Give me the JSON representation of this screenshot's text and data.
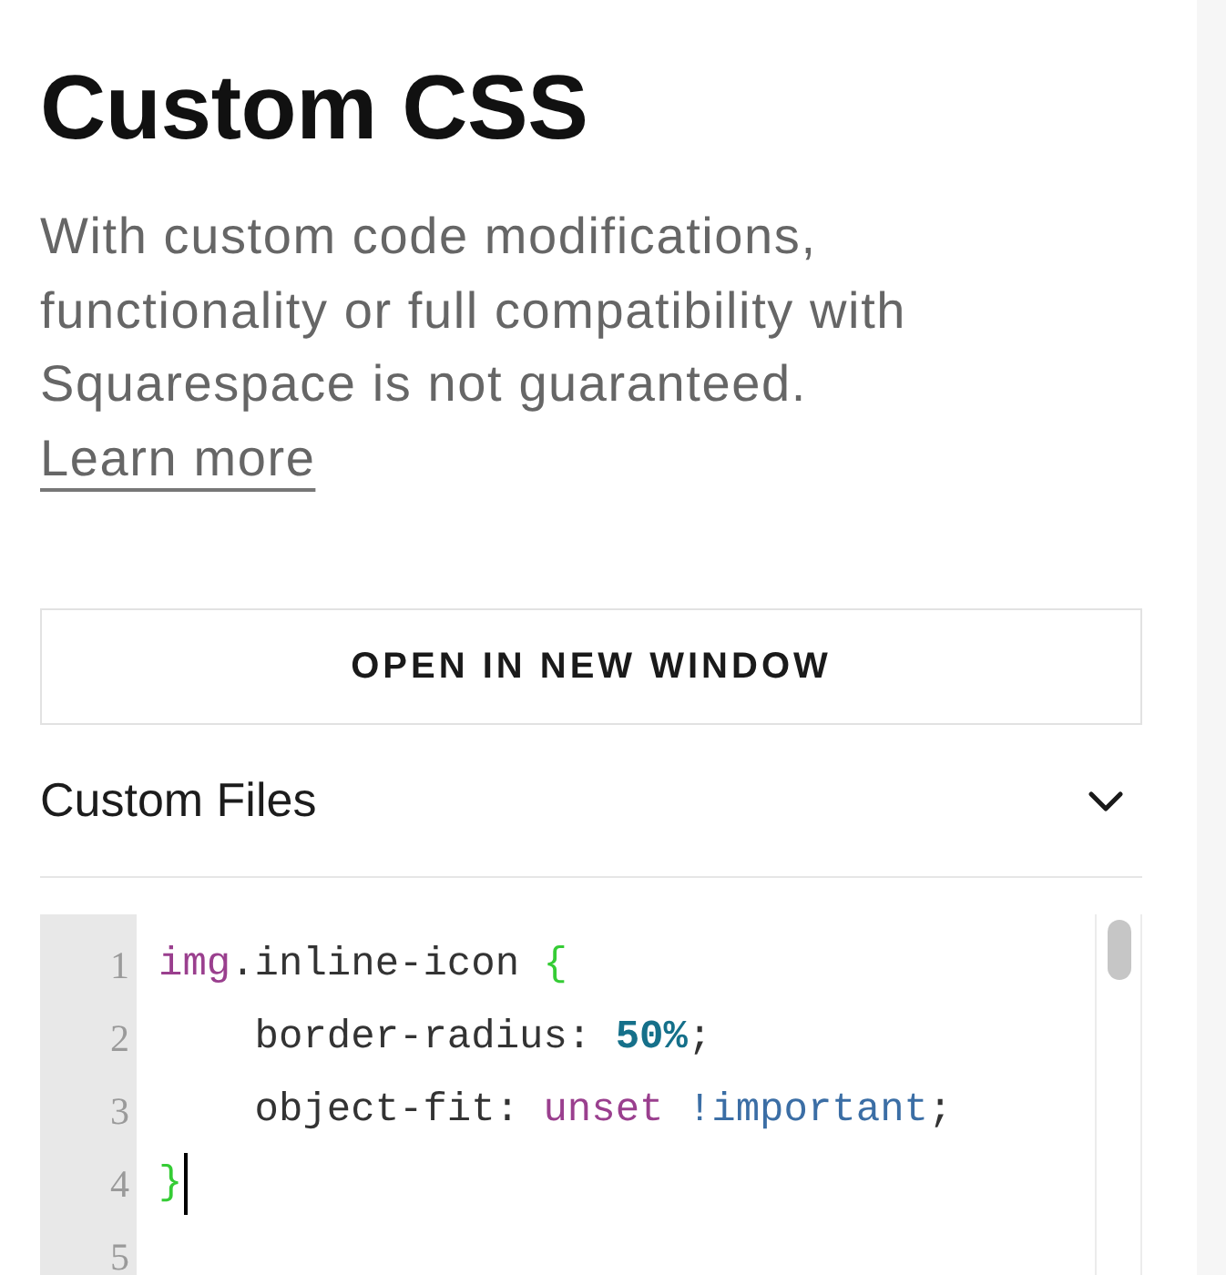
{
  "page": {
    "title": "Custom CSS",
    "description": "With custom code modifications, functionality or full compatibility with Squarespace is not guaranteed.",
    "link": "Learn more"
  },
  "open_button": {
    "label": "OPEN IN NEW WINDOW"
  },
  "section": {
    "label": "Custom Files",
    "expanded": false
  },
  "editor": {
    "lines": [
      {
        "number": "1",
        "cursor": false,
        "tokens": [
          {
            "kind": "tag",
            "text": "img"
          },
          {
            "kind": "text",
            "text": ".inline-icon "
          },
          {
            "kind": "brace",
            "text": "{"
          }
        ]
      },
      {
        "number": "2",
        "cursor": false,
        "tokens": [
          {
            "kind": "text",
            "text": "    border-radius: "
          },
          {
            "kind": "number",
            "text": "50%"
          },
          {
            "kind": "text",
            "text": ";"
          }
        ]
      },
      {
        "number": "3",
        "cursor": false,
        "tokens": [
          {
            "kind": "text",
            "text": "    object-fit: "
          },
          {
            "kind": "keyword",
            "text": "unset "
          },
          {
            "kind": "important",
            "text": "!important"
          },
          {
            "kind": "text",
            "text": ";"
          }
        ]
      },
      {
        "number": "4",
        "cursor": true,
        "tokens": [
          {
            "kind": "brace",
            "text": "}"
          }
        ]
      },
      {
        "number": "5",
        "cursor": false
      }
    ]
  }
}
